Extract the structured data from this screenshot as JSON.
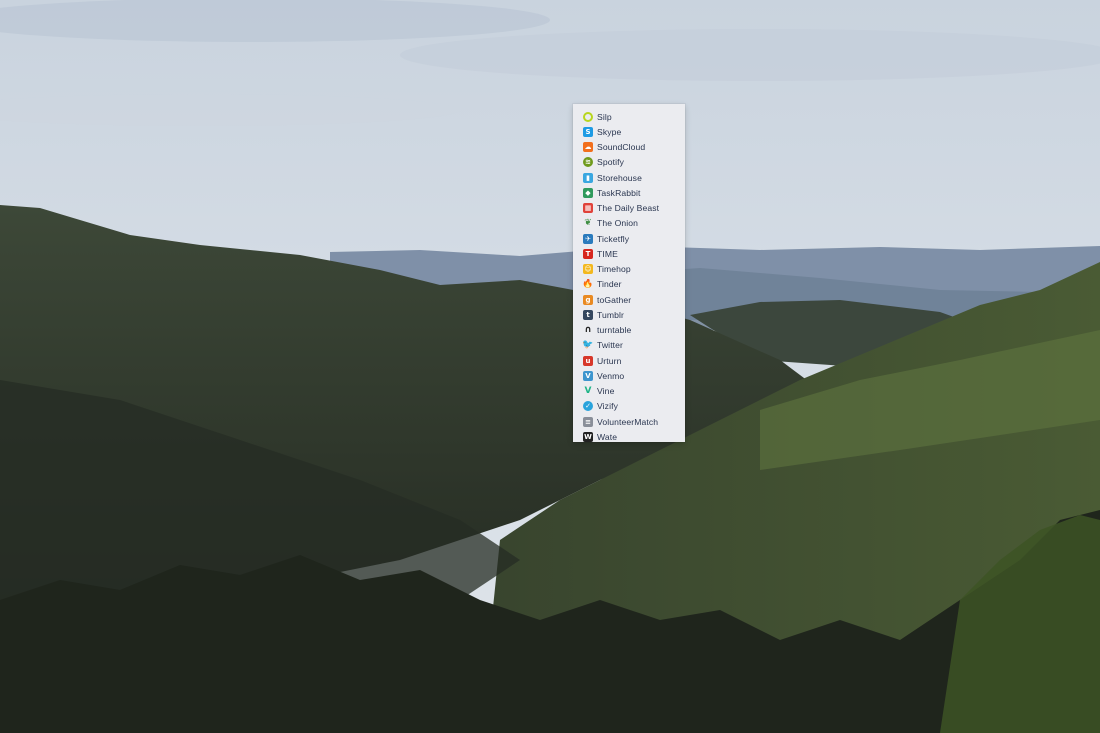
{
  "apps": [
    {
      "label": "Silp",
      "icon": "silp-icon",
      "color": "#b8d61e",
      "shape": "ring",
      "glyph": ""
    },
    {
      "label": "Skype",
      "icon": "skype-icon",
      "color": "#1e9be4",
      "shape": "square",
      "glyph": "S"
    },
    {
      "label": "SoundCloud",
      "icon": "soundcloud-icon",
      "color": "#f26f1d",
      "shape": "square",
      "glyph": "☁"
    },
    {
      "label": "Spotify",
      "icon": "spotify-icon",
      "color": "#6f9a1c",
      "shape": "round",
      "glyph": "≋"
    },
    {
      "label": "Storehouse",
      "icon": "storehouse-icon",
      "color": "#3aa7e0",
      "shape": "square",
      "glyph": "▮"
    },
    {
      "label": "TaskRabbit",
      "icon": "taskrabbit-icon",
      "color": "#2f9a5d",
      "shape": "square",
      "glyph": "◆"
    },
    {
      "label": "The Daily Beast",
      "icon": "daily-beast-icon",
      "color": "#e0423a",
      "shape": "square",
      "glyph": "▦"
    },
    {
      "label": "The Onion",
      "icon": "onion-icon",
      "color": "#3e8e42",
      "shape": "plain",
      "glyph": "❦"
    },
    {
      "label": "Ticketfly",
      "icon": "ticketfly-icon",
      "color": "#2b7bbd",
      "shape": "square",
      "glyph": "✈"
    },
    {
      "label": "TIME",
      "icon": "time-icon",
      "color": "#d7261e",
      "shape": "square",
      "glyph": "T"
    },
    {
      "label": "Timehop",
      "icon": "timehop-icon",
      "color": "#f3b81e",
      "shape": "square",
      "glyph": "☺"
    },
    {
      "label": "Tinder",
      "icon": "tinder-icon",
      "color": "#ef5a2c",
      "shape": "plain",
      "glyph": "🔥"
    },
    {
      "label": "toGather",
      "icon": "together-icon",
      "color": "#e98a22",
      "shape": "square",
      "glyph": "g"
    },
    {
      "label": "Tumblr",
      "icon": "tumblr-icon",
      "color": "#35475f",
      "shape": "square",
      "glyph": "t"
    },
    {
      "label": "turntable",
      "icon": "headphones-icon",
      "color": "#222222",
      "shape": "plain",
      "glyph": "∩"
    },
    {
      "label": "Twitter",
      "icon": "twitter-icon",
      "color": "#2aa9e0",
      "shape": "plain",
      "glyph": "🐦"
    },
    {
      "label": "Urturn",
      "icon": "urturn-icon",
      "color": "#d7372a",
      "shape": "square",
      "glyph": "u"
    },
    {
      "label": "Venmo",
      "icon": "venmo-icon",
      "color": "#3d95ce",
      "shape": "square",
      "glyph": "V"
    },
    {
      "label": "Vine",
      "icon": "vine-icon",
      "color": "#1fb487",
      "shape": "plain",
      "glyph": "V"
    },
    {
      "label": "Vizify",
      "icon": "vizify-icon",
      "color": "#29a3dc",
      "shape": "round",
      "glyph": "✓"
    },
    {
      "label": "VolunteerMatch",
      "icon": "volunteermatch-icon",
      "color": "#8a8f99",
      "shape": "square",
      "glyph": "≡"
    },
    {
      "label": "Wate",
      "icon": "watch-icon",
      "color": "#222222",
      "shape": "square",
      "glyph": "W"
    }
  ]
}
